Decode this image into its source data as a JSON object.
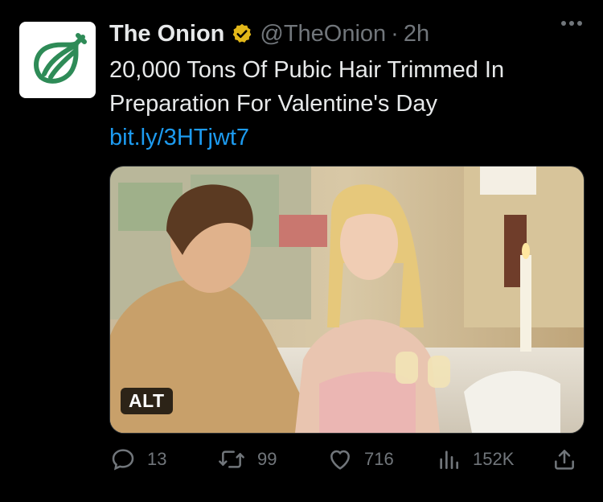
{
  "tweet": {
    "author_name": "The Onion",
    "handle": "@TheOnion",
    "separator": "·",
    "time": "2h",
    "text": "20,000 Tons Of Pubic Hair Trimmed In Preparation For Valentine's Day ",
    "link_text": "bit.ly/3HTjwt7",
    "alt_badge": "ALT"
  },
  "actions": {
    "replies": "13",
    "retweets": "99",
    "likes": "716",
    "views": "152K"
  },
  "colors": {
    "background": "#000000",
    "text": "#e7e9ea",
    "muted": "#71767b",
    "link": "#1d9bf0",
    "verified_gold": "#e2b719",
    "onion_green": "#2e8b57"
  },
  "icons": {
    "avatar": "onion-logo-icon",
    "verified": "verified-badge-icon",
    "more": "more-icon",
    "reply": "reply-icon",
    "retweet": "retweet-icon",
    "like": "like-icon",
    "views": "views-icon",
    "share": "share-icon"
  }
}
